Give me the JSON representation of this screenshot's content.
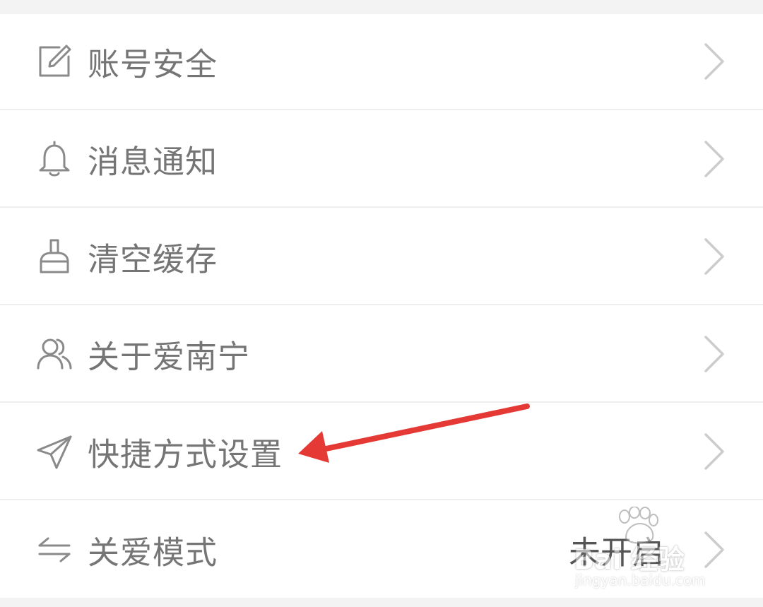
{
  "settings": {
    "items": [
      {
        "label": "账号安全",
        "icon": "edit-icon",
        "value": ""
      },
      {
        "label": "消息通知",
        "icon": "bell-icon",
        "value": ""
      },
      {
        "label": "清空缓存",
        "icon": "broom-icon",
        "value": ""
      },
      {
        "label": "关于爱南宁",
        "icon": "users-icon",
        "value": ""
      },
      {
        "label": "快捷方式设置",
        "icon": "send-icon",
        "value": ""
      },
      {
        "label": "关爱模式",
        "icon": "swap-arrows-icon",
        "value": "未开启"
      }
    ]
  },
  "annotation": {
    "color": "#e53935",
    "target": "快捷方式设置"
  },
  "watermark": {
    "brand": "Bai 经验",
    "url": "jingyan.baidu.com"
  },
  "colors": {
    "background": "#f3f3f3",
    "row": "#ffffff",
    "divider": "#eeeeee",
    "label": "#757575",
    "icon": "#8a8a8a",
    "chevron": "#cccccc"
  }
}
